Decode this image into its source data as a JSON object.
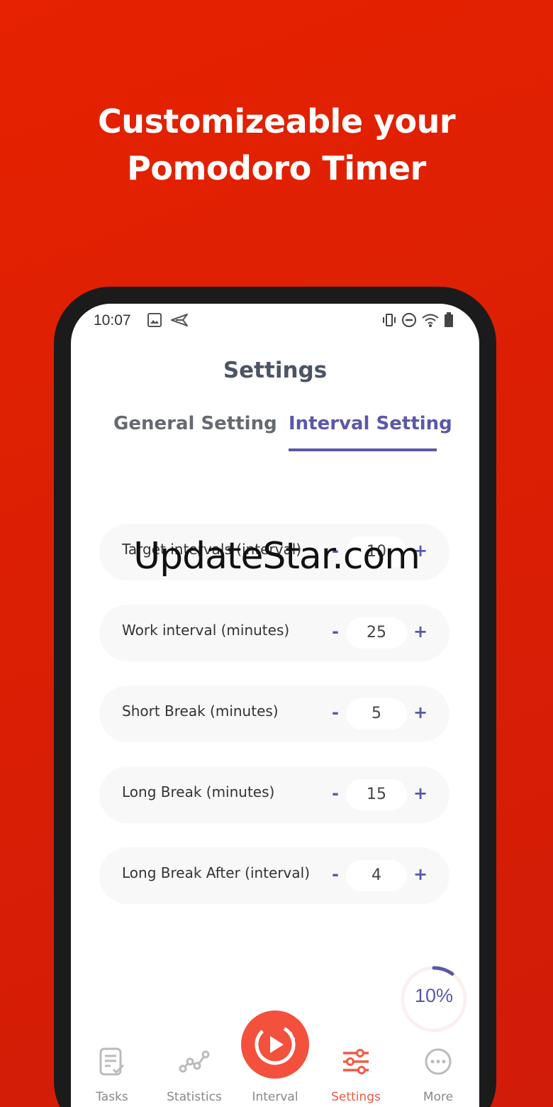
{
  "promo": {
    "line1": "Customizeable your",
    "line2": "Pomodoro Timer"
  },
  "status_bar": {
    "time": "10:07"
  },
  "header": {
    "title": "Settings"
  },
  "tabs": [
    {
      "label": "General Setting",
      "active": false
    },
    {
      "label": "Interval Setting",
      "active": true
    }
  ],
  "settings": [
    {
      "label": "Target intervals (interval)",
      "value": "10",
      "minus": "-",
      "plus": "+"
    },
    {
      "label": "Work interval (minutes)",
      "value": "25",
      "minus": "-",
      "plus": "+"
    },
    {
      "label": "Short Break (minutes)",
      "value": "5",
      "minus": "-",
      "plus": "+"
    },
    {
      "label": "Long Break (minutes)",
      "value": "15",
      "minus": "-",
      "plus": "+"
    },
    {
      "label": "Long Break After (interval)",
      "value": "4",
      "minus": "-",
      "plus": "+"
    }
  ],
  "progress": {
    "label": "10%",
    "fraction": 0.1
  },
  "watermark": "UpdateStar.com",
  "nav": [
    {
      "label": "Tasks",
      "icon": "tasks-icon"
    },
    {
      "label": "Statistics",
      "icon": "statistics-icon"
    },
    {
      "label": "Interval",
      "icon": "play-icon"
    },
    {
      "label": "Settings",
      "icon": "sliders-icon",
      "active": true
    },
    {
      "label": "More",
      "icon": "more-icon"
    }
  ],
  "colors": {
    "background": "#e02003",
    "accent": "#5a58a8",
    "active_nav": "#f25a44",
    "play_button": "#f4503e"
  }
}
